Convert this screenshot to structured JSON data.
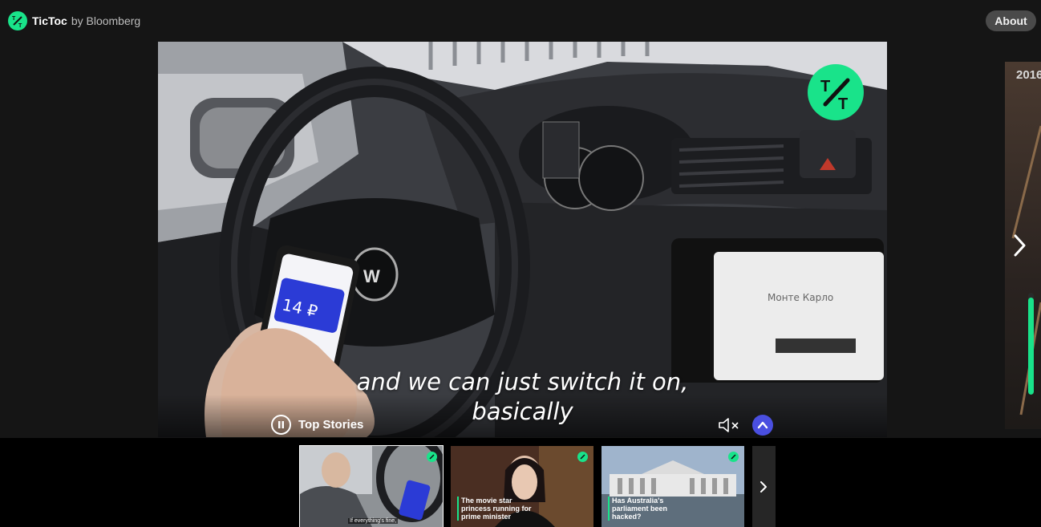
{
  "header": {
    "brand_name": "TicToc",
    "brand_by": "by Bloomberg",
    "about_label": "About"
  },
  "player": {
    "subtitle_lines": [
      "and we can just switch it on,",
      "basically"
    ],
    "playlist_title": "Top Stories",
    "progress_fraction": 0.95,
    "phone_screen_text": "14 ₽",
    "car_screen_text": "Монте Карло"
  },
  "right_peek": {
    "label": "2016"
  },
  "thumbnails": [
    {
      "caption": "",
      "subtitle": "If everything's fine,",
      "active": true
    },
    {
      "caption": "The movie star princess running for prime minister",
      "subtitle": "",
      "active": false
    },
    {
      "caption": "Has Australia's parliament been hacked?",
      "subtitle": "",
      "active": false
    }
  ],
  "colors": {
    "accent": "#19e38a",
    "control_blue": "#4a4fe0",
    "background": "#151515"
  },
  "icons": {
    "logo": "tictoc-logo-icon",
    "pause": "pause-icon",
    "mute": "mute-icon",
    "collapse": "chevron-up-icon",
    "next": "chevron-right-icon"
  }
}
